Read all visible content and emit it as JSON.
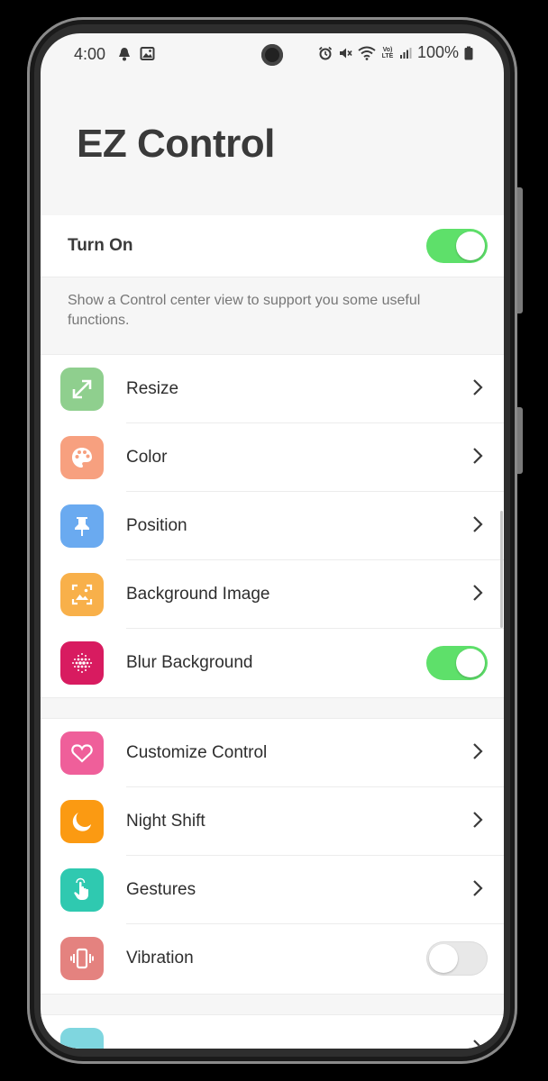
{
  "status_bar": {
    "time": "4:00",
    "battery": "100%",
    "network_label": "Vo) LTE"
  },
  "app": {
    "title": "EZ Control"
  },
  "turn_on": {
    "label": "Turn On",
    "enabled": true
  },
  "description": "Show a Control center view to support you some useful functions.",
  "group1": [
    {
      "label": "Resize",
      "icon": "resize-icon",
      "color": "#8fcf8e",
      "control": "chevron"
    },
    {
      "label": "Color",
      "icon": "palette-icon",
      "color": "#f7a07f",
      "control": "chevron"
    },
    {
      "label": "Position",
      "icon": "pin-icon",
      "color": "#6aaaf0",
      "control": "chevron"
    },
    {
      "label": "Background Image",
      "icon": "image-icon",
      "color": "#f8b04a",
      "control": "chevron"
    },
    {
      "label": "Blur Background",
      "icon": "blur-icon",
      "color": "#d81b60",
      "control": "toggle",
      "enabled": true
    }
  ],
  "group2": [
    {
      "label": "Customize Control",
      "icon": "heart-icon",
      "color": "#ef5f9a",
      "control": "chevron"
    },
    {
      "label": "Night Shift",
      "icon": "moon-icon",
      "color": "#fb9a12",
      "control": "chevron"
    },
    {
      "label": "Gestures",
      "icon": "hand-icon",
      "color": "#2fc9b0",
      "control": "chevron"
    },
    {
      "label": "Vibration",
      "icon": "vibration-icon",
      "color": "#e4827f",
      "control": "toggle",
      "enabled": false
    }
  ],
  "group3_partial_icon_color": "#7fd6df"
}
